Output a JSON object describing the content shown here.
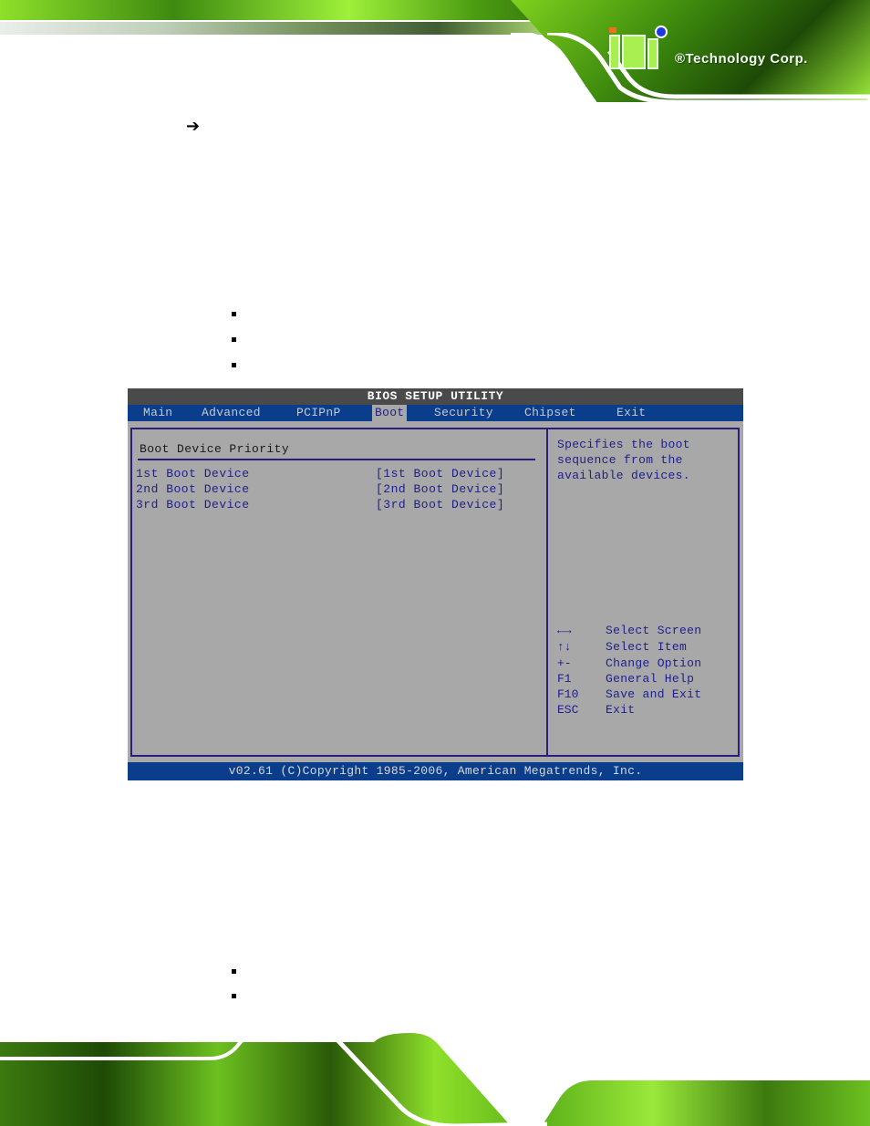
{
  "header": {
    "logo_text": "®Technology Corp."
  },
  "page": {
    "arrow_glyph": "➔"
  },
  "bios": {
    "title": "BIOS SETUP UTILITY",
    "menu": [
      {
        "label": "Main",
        "active": false
      },
      {
        "label": "Advanced",
        "active": false
      },
      {
        "label": "PCIPnP",
        "active": false
      },
      {
        "label": "Boot",
        "active": true
      },
      {
        "label": "Security",
        "active": false
      },
      {
        "label": "Chipset",
        "active": false
      },
      {
        "label": "Exit",
        "active": false
      }
    ],
    "section_title": "Boot Device Priority",
    "rows": [
      {
        "label": "1st Boot Device",
        "value": "[1st Boot Device]"
      },
      {
        "label": "2nd Boot Device",
        "value": "[2nd Boot Device]"
      },
      {
        "label": "3rd Boot Device",
        "value": "[3rd Boot Device]"
      }
    ],
    "help_text": "Specifies the boot\nsequence from the\navailable devices.",
    "keys": [
      {
        "key": "←→",
        "desc": "Select Screen"
      },
      {
        "key": "↑↓",
        "desc": "Select Item"
      },
      {
        "key": "+-",
        "desc": "Change Option"
      },
      {
        "key": "F1",
        "desc": "General Help"
      },
      {
        "key": "F10",
        "desc": "Save and Exit"
      },
      {
        "key": "ESC",
        "desc": "Exit"
      }
    ],
    "footer": "v02.61 (C)Copyright 1985-2006, American Megatrends, Inc."
  },
  "colors": {
    "bios_background": "#a8a8a8",
    "bios_menubar": "#0a3e8c",
    "bios_titlebar": "#4a4a4a",
    "bios_text": "#1e1e8c",
    "bios_border": "#2a1e78",
    "brand_green": "#7fd21e"
  }
}
